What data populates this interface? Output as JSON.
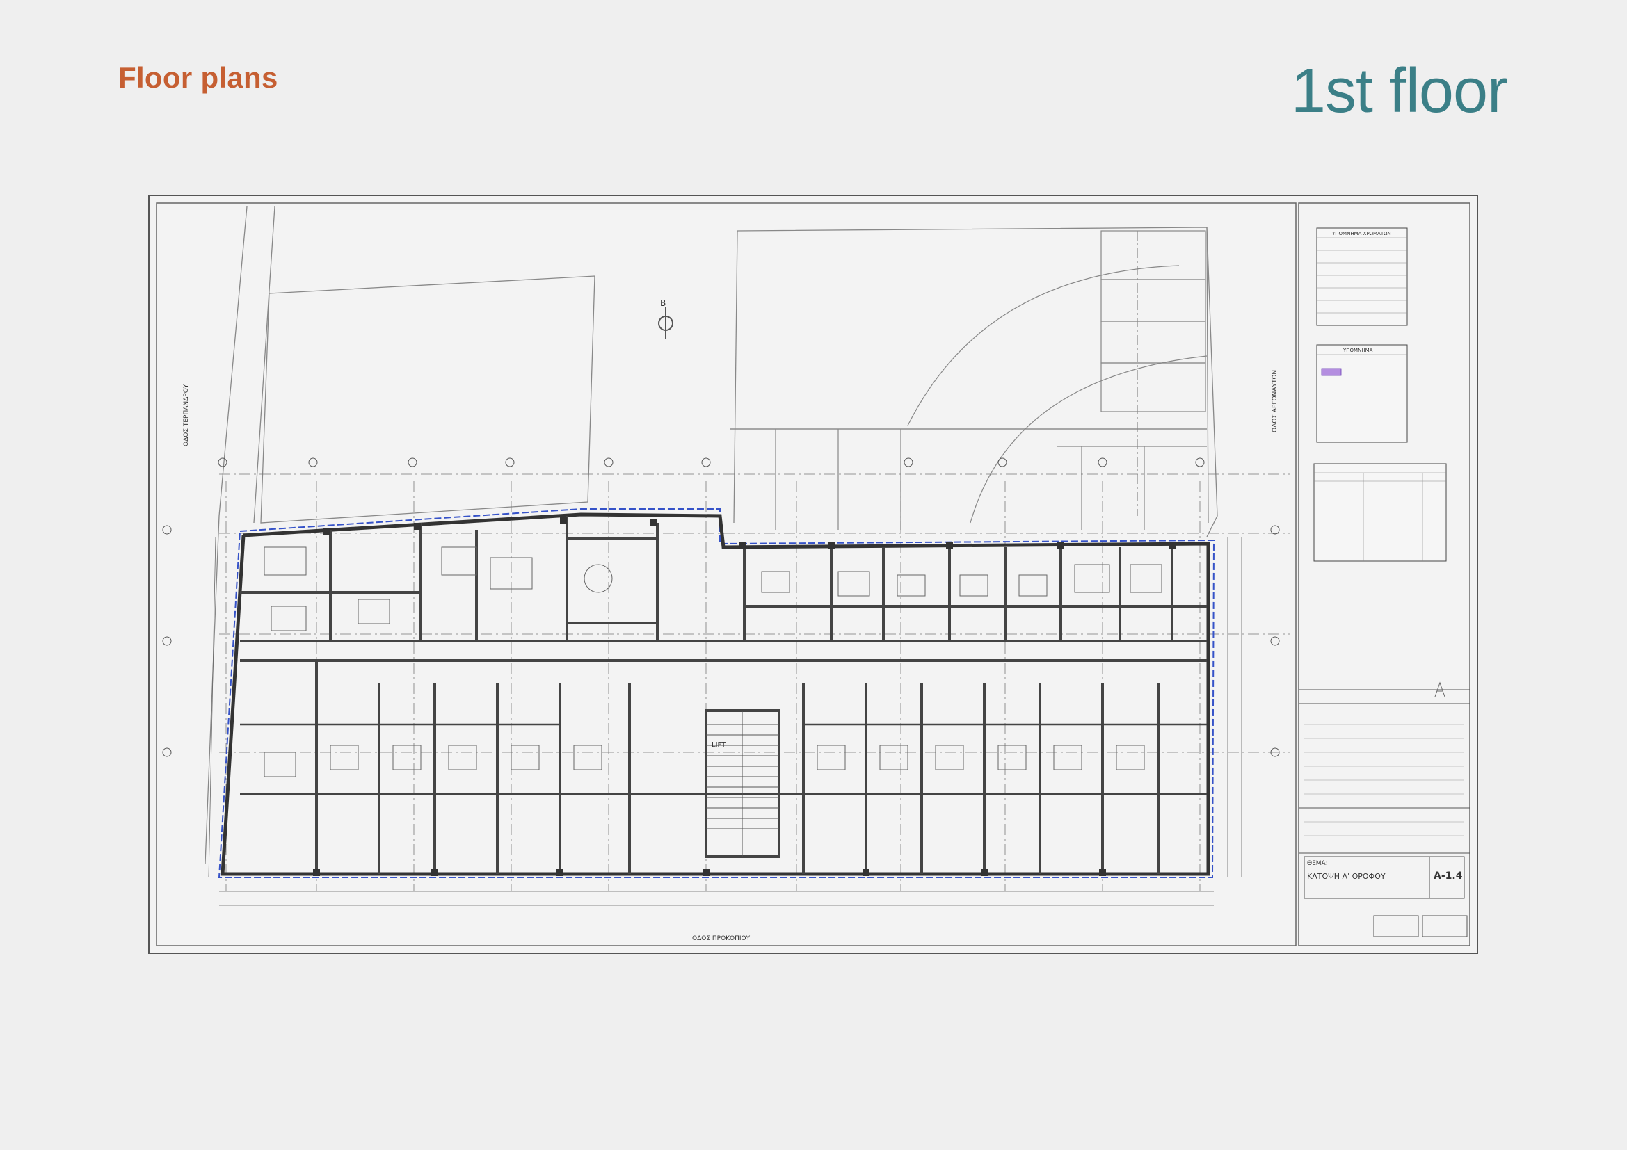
{
  "header": {
    "section_title": "Floor plans",
    "floor_title": "1st floor"
  },
  "drawing": {
    "sheet_title": "ΚΑΤΟΨΗ Α' ΟΡΟΦΟΥ",
    "sheet_number": "Α-1.4",
    "theme_label": "ΘΕΜΑ:",
    "street_bottom": "ΟΔΟΣ ΠΡΟΚΟΠΙΟΥ",
    "street_left": "ΟΔΟΣ ΤΕΡΠΑΝΔΡΟΥ",
    "street_right": "ΟΔΟΣ ΑΡΓΟΝΑΥΤΩΝ",
    "legend_title_1": "ΥΠΟΜΝΗΜΑ ΧΡΩΜΑΤΩΝ",
    "legend_title_2": "ΥΠΟΜΝΗΜΑ",
    "lift_label": "LIFT",
    "north_label": "B"
  }
}
